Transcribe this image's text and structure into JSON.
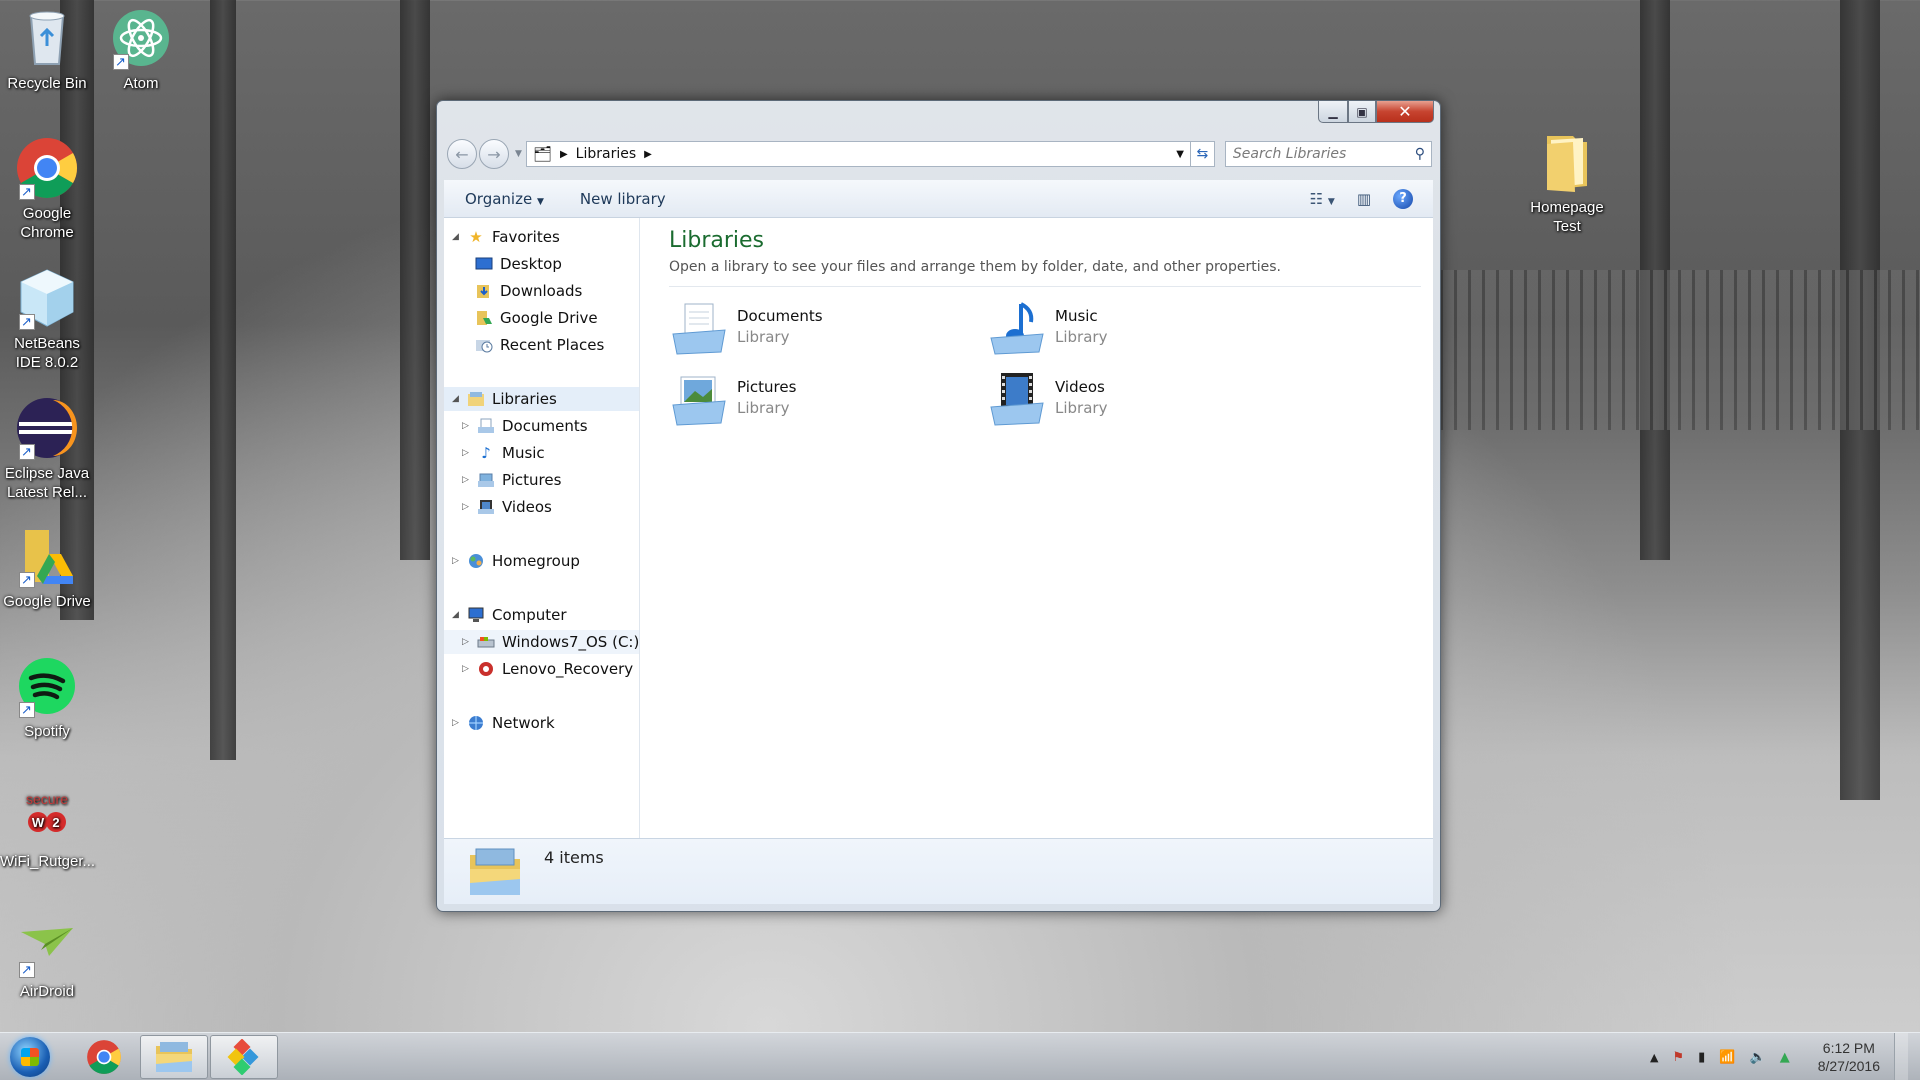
{
  "desktop": {
    "icons": [
      {
        "label": "Recycle Bin",
        "icon": "recycle-bin-icon"
      },
      {
        "label": "Atom",
        "icon": "atom-icon"
      },
      {
        "label": "Google Chrome",
        "icon": "chrome-icon"
      },
      {
        "label": "NetBeans IDE 8.0.2",
        "icon": "netbeans-icon"
      },
      {
        "label": "Eclipse Java Latest Rel...",
        "icon": "eclipse-icon"
      },
      {
        "label": "Google Drive",
        "icon": "google-drive-icon"
      },
      {
        "label": "Spotify",
        "icon": "spotify-icon"
      },
      {
        "label": "WiFi_Rutger...",
        "icon": "securew2-icon",
        "logo_text": "secure W2"
      },
      {
        "label": "AirDroid",
        "icon": "airdroid-icon"
      },
      {
        "label": "Homepage Test",
        "icon": "folder-icon"
      }
    ]
  },
  "window": {
    "address": {
      "crumb": "Libraries"
    },
    "search": {
      "placeholder": "Search Libraries"
    },
    "toolbar": {
      "organize": "Organize",
      "new_library": "New library"
    },
    "nav": {
      "favorites": "Favorites",
      "favorites_items": [
        "Desktop",
        "Downloads",
        "Google Drive",
        "Recent Places"
      ],
      "libraries": "Libraries",
      "libraries_items": [
        "Documents",
        "Music",
        "Pictures",
        "Videos"
      ],
      "homegroup": "Homegroup",
      "computer": "Computer",
      "computer_items": [
        "Windows7_OS (C:)",
        "Lenovo_Recovery (Q:"
      ],
      "network": "Network"
    },
    "content": {
      "title": "Libraries",
      "subtitle": "Open a library to see your files and arrange them by folder, date, and other properties.",
      "libraries": [
        {
          "name": "Documents",
          "type": "Library"
        },
        {
          "name": "Music",
          "type": "Library"
        },
        {
          "name": "Pictures",
          "type": "Library"
        },
        {
          "name": "Videos",
          "type": "Library"
        }
      ]
    },
    "details": {
      "count": "4 items"
    }
  },
  "taskbar": {
    "clock_time": "6:12 PM",
    "clock_date": "8/27/2016"
  },
  "colors": {
    "title_green": "#1a6b2f",
    "close_red": "#c74430",
    "selection_blue": "#e4eef9"
  }
}
